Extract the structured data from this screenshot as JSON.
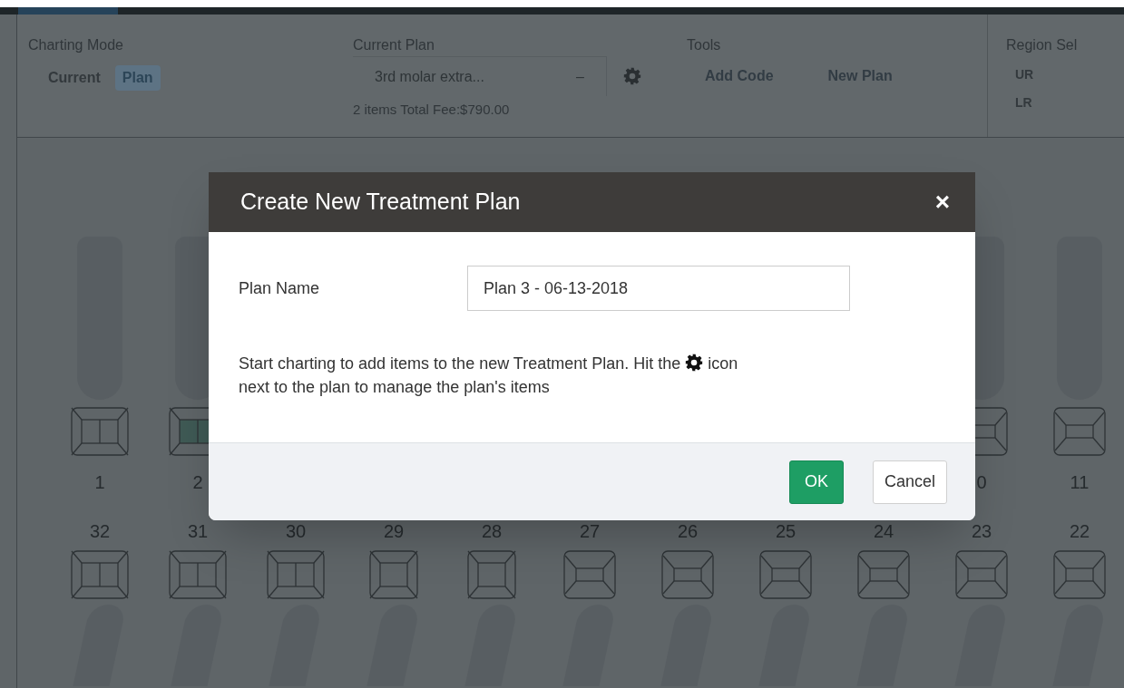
{
  "toolbar": {
    "charting_mode": {
      "label": "Charting Mode",
      "options": [
        {
          "label": "Current",
          "selected": false
        },
        {
          "label": "Plan",
          "selected": true
        }
      ]
    },
    "current_plan": {
      "label": "Current Plan",
      "value": "3rd molar extra...",
      "caret": "–",
      "summary": "2 items Total Fee:$790.00"
    },
    "tools": {
      "label": "Tools",
      "buttons": [
        "Add Code",
        "New Plan"
      ]
    },
    "region_select": {
      "label": "Region Sel",
      "options": [
        "UR",
        "LR"
      ]
    }
  },
  "upper_teeth": [
    {
      "number": "1",
      "kind": "molar",
      "planned": false
    },
    {
      "number": "2",
      "kind": "molar",
      "planned": true
    },
    {
      "kind": "hidden"
    },
    {
      "kind": "hidden"
    },
    {
      "kind": "hidden"
    },
    {
      "kind": "hidden"
    },
    {
      "kind": "hidden"
    },
    {
      "kind": "hidden"
    },
    {
      "kind": "hidden"
    },
    {
      "number": "0",
      "kind": "anterior",
      "planned": false
    },
    {
      "number": "11",
      "kind": "anterior",
      "planned": false
    }
  ],
  "lower_teeth": [
    {
      "number": "32",
      "kind": "molar",
      "planned": false
    },
    {
      "number": "31",
      "kind": "molar",
      "planned": false
    },
    {
      "number": "30",
      "kind": "molar",
      "planned": false
    },
    {
      "number": "29",
      "kind": "premolar",
      "planned": false
    },
    {
      "number": "28",
      "kind": "premolar",
      "planned": false
    },
    {
      "number": "27",
      "kind": "anterior",
      "planned": false
    },
    {
      "number": "26",
      "kind": "anterior",
      "planned": false
    },
    {
      "number": "25",
      "kind": "anterior",
      "planned": false
    },
    {
      "number": "24",
      "kind": "anterior",
      "planned": false
    },
    {
      "number": "23",
      "kind": "anterior",
      "planned": false
    },
    {
      "number": "22",
      "kind": "anterior",
      "planned": false
    }
  ],
  "dialog": {
    "title": "Create New Treatment Plan",
    "close": "×",
    "field_label": "Plan Name",
    "field_value": "Plan 3 - 06-13-2018",
    "hint": {
      "before_icon": "Start charting to add items to the new Treatment Plan. Hit the",
      "after_icon": "icon",
      "second_line": "next to the plan to manage the plan's items"
    },
    "buttons": [
      {
        "label": "OK",
        "kind": "primary"
      },
      {
        "label": "Cancel",
        "kind": "secondary"
      }
    ]
  }
}
